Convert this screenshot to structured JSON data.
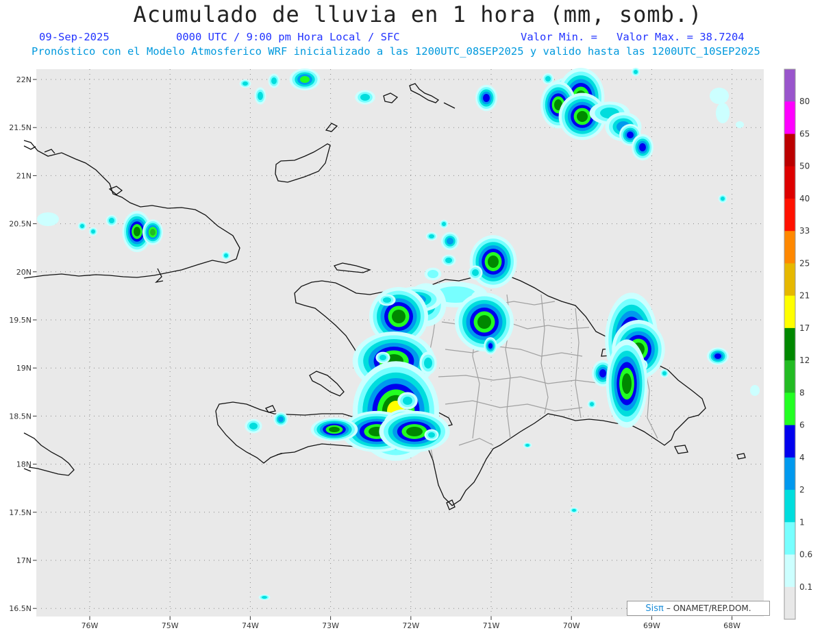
{
  "header": {
    "title": "Acumulado de lluvia en 1 hora (mm, somb.)",
    "date": "09-Sep-2025",
    "time": "0000 UTC / 9:00 pm Hora Local / SFC",
    "vmin": "Valor Min. =",
    "vmax": "Valor Max. = 38.7204",
    "subtitle": "Pronóstico con el Modelo Atmosferico WRF inicializado a las 1200UTC_08SEP2025 y valido hasta las  1200UTC_10SEP2025"
  },
  "axes": {
    "lat_labels": [
      "22N",
      "21.5N",
      "21N",
      "20.5N",
      "20N",
      "19.5N",
      "19N",
      "18.5N",
      "18N",
      "17.5N",
      "17N",
      "16.5N"
    ],
    "lon_labels": [
      "76W",
      "75W",
      "74W",
      "73W",
      "72W",
      "71W",
      "70W",
      "69W",
      "68W"
    ]
  },
  "legend": {
    "labels": [
      "80",
      "65",
      "50",
      "40",
      "33",
      "25",
      "21",
      "17",
      "12",
      "8",
      "6",
      "4",
      "2",
      "1",
      "0.6",
      "0.1"
    ],
    "colors": [
      "#9955cc",
      "#ff00ff",
      "#bb0000",
      "#dd0000",
      "#ff1100",
      "#ff8800",
      "#e6b800",
      "#ffff00",
      "#008800",
      "#22bb22",
      "#22ff22",
      "#0000ee",
      "#0099ee",
      "#00dddd",
      "#77ffff",
      "#ccffff",
      "#e8e8e8"
    ]
  },
  "credit": {
    "brand": "Sisπ",
    "text": "– ONAMET/REP.DOM."
  }
}
